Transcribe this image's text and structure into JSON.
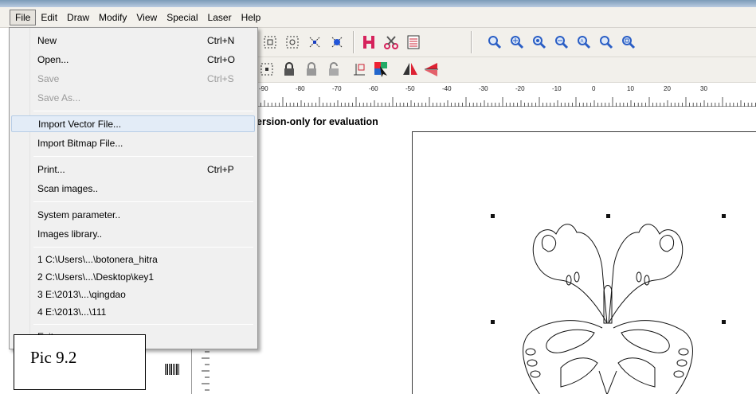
{
  "menubar": {
    "items": [
      {
        "label": "File",
        "active": true
      },
      {
        "label": "Edit"
      },
      {
        "label": "Draw"
      },
      {
        "label": "Modify"
      },
      {
        "label": "View"
      },
      {
        "label": "Special"
      },
      {
        "label": "Laser"
      },
      {
        "label": "Help"
      }
    ]
  },
  "file_menu": {
    "items": [
      {
        "label": "New",
        "shortcut": "Ctrl+N",
        "enabled": true
      },
      {
        "label": "Open...",
        "shortcut": "Ctrl+O",
        "enabled": true
      },
      {
        "label": "Save",
        "shortcut": "Ctrl+S",
        "enabled": false
      },
      {
        "label": "Save As...",
        "shortcut": "",
        "enabled": false
      },
      {
        "label": "Import Vector File...",
        "shortcut": "",
        "enabled": true,
        "highlighted": true
      },
      {
        "label": "Import Bitmap File...",
        "shortcut": "",
        "enabled": true
      },
      {
        "label": "Print...",
        "shortcut": "Ctrl+P",
        "enabled": true
      },
      {
        "label": "Scan images..",
        "shortcut": "",
        "enabled": true
      },
      {
        "label": "System parameter..",
        "shortcut": "",
        "enabled": true
      },
      {
        "label": "Images library..",
        "shortcut": "",
        "enabled": true
      },
      {
        "label": "1 C:\\Users\\...\\botonera_hitra",
        "shortcut": "",
        "enabled": true
      },
      {
        "label": "2 C:\\Users\\...\\Desktop\\key1",
        "shortcut": "",
        "enabled": true
      },
      {
        "label": "3 E:\\2013\\...\\qingdao",
        "shortcut": "",
        "enabled": true
      },
      {
        "label": "4 E:\\2013\\...\\111",
        "shortcut": "",
        "enabled": true
      },
      {
        "label": "Exit",
        "shortcut": "",
        "enabled": true
      }
    ]
  },
  "ruler": {
    "labels": [
      "-90",
      "-80",
      "-70",
      "-60",
      "-50",
      "-40",
      "-30",
      "-20",
      "-10",
      "0",
      "10",
      "20",
      "30"
    ]
  },
  "canvas": {
    "watermark": "ersion-only for evaluation"
  },
  "caption": "Pic 9.2",
  "toolbar": {
    "icons": [
      "group-icon",
      "ungroup-icon",
      "node-edit-icon",
      "select-nodes-icon",
      "h-icon",
      "scissors-icon",
      "list-icon",
      "zoom-icon",
      "zoom-in-icon",
      "zoom-fit-icon",
      "zoom-out-icon",
      "zoom-all-icon",
      "zoom-prev-icon",
      "zoom-page-icon",
      "align-icon",
      "lock-icon",
      "lock2-icon",
      "unlock-icon",
      "origin-icon",
      "color-cursor-icon",
      "mirror-h-icon",
      "mirror-v-icon"
    ]
  }
}
